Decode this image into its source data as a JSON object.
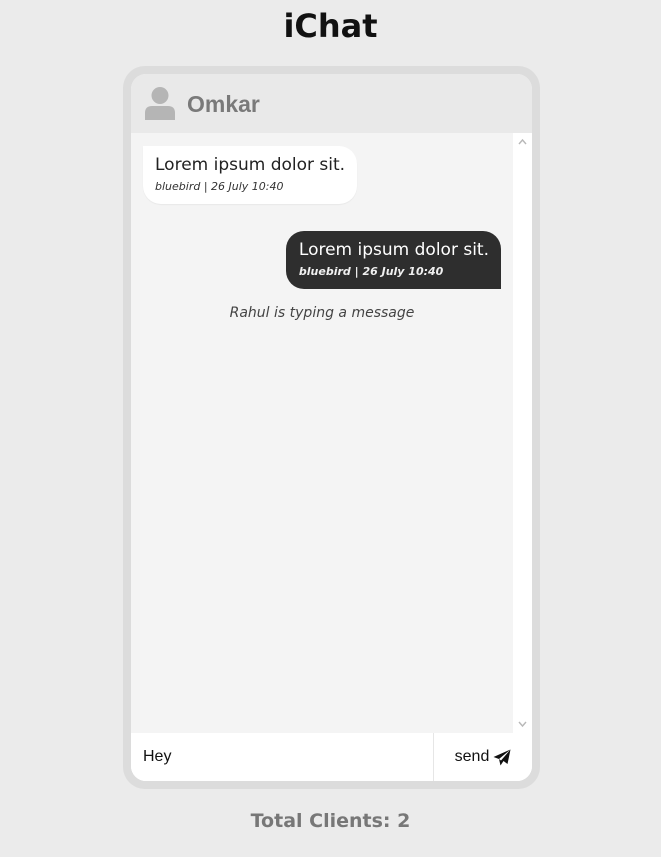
{
  "app": {
    "title": "iChat"
  },
  "header": {
    "contact_name": "Omkar",
    "icon": "user-icon"
  },
  "messages": [
    {
      "direction": "incoming",
      "text": "Lorem ipsum dolor sit.",
      "meta": "bluebird | 26 July 10:40"
    },
    {
      "direction": "outgoing",
      "text": "Lorem ipsum dolor sit.",
      "meta": "bluebird | 26 July 10:40"
    }
  ],
  "typing_indicator": "Rahul is typing a message",
  "composer": {
    "input_value": "Hey",
    "send_label": "send",
    "send_icon": "paper-plane-icon"
  },
  "footer": {
    "total_clients": "Total Clients: 2"
  },
  "colors": {
    "page_bg": "#ebebeb",
    "outgoing_bubble": "#2e2e2e",
    "incoming_bubble": "#ffffff",
    "chat_bg": "#f4f4f4"
  }
}
